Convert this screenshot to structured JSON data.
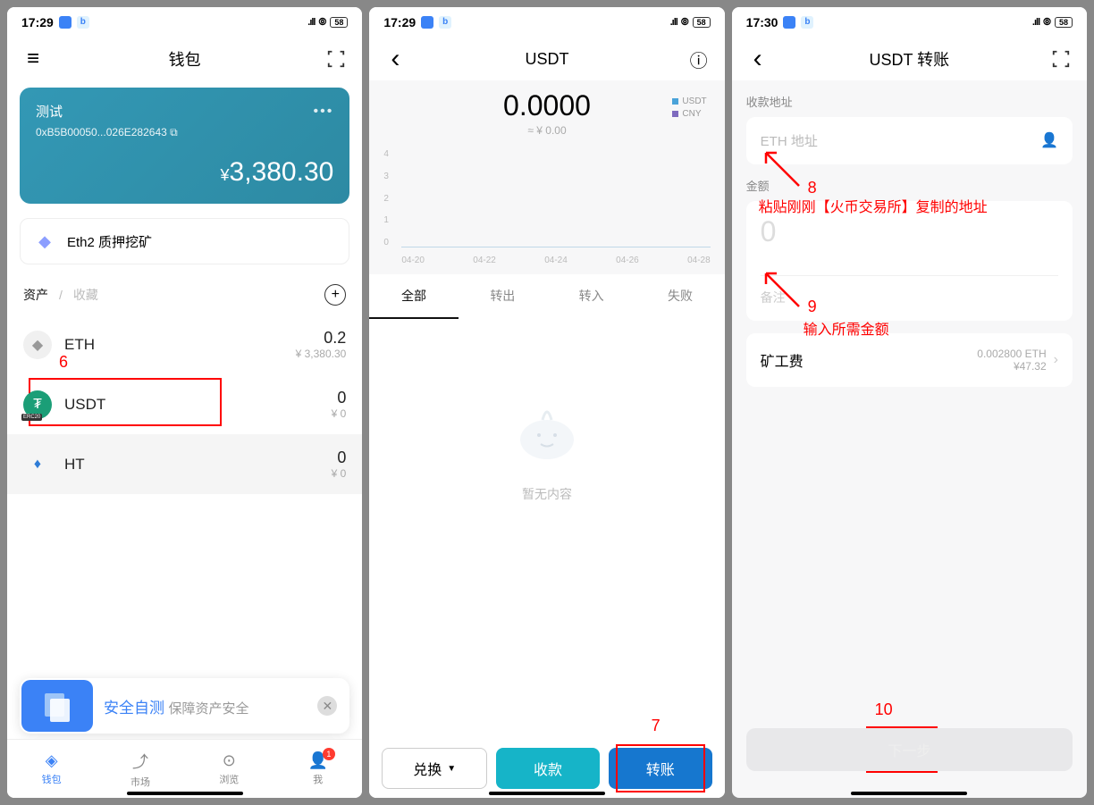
{
  "screen1": {
    "status": {
      "time": "17:29",
      "battery": "58"
    },
    "header": {
      "title": "钱包"
    },
    "wallet_card": {
      "name": "测试",
      "addr": "0xB5B00050...026E282643",
      "balance": "3,380.30",
      "currency": "¥"
    },
    "eth2_row": "Eth2 质押挖矿",
    "sections": {
      "assets": "资产",
      "favorites": "收藏"
    },
    "assets": [
      {
        "sym": "ETH",
        "bal": "0.2",
        "fiat": "¥ 3,380.30"
      },
      {
        "sym": "USDT",
        "bal": "0",
        "fiat": "¥ 0"
      },
      {
        "sym": "HT",
        "bal": "0",
        "fiat": "¥ 0"
      }
    ],
    "promo": {
      "title": "安全自测",
      "sub": "保障资产安全"
    },
    "tabs": {
      "wallet": "钱包",
      "market": "市场",
      "browse": "浏览",
      "me": "我",
      "badge": "1"
    },
    "annotation": "6"
  },
  "screen2": {
    "status": {
      "time": "17:29",
      "battery": "58"
    },
    "header": {
      "title": "USDT"
    },
    "balance": "0.0000",
    "balance_fiat": "≈ ¥ 0.00",
    "legend": {
      "usdt": "USDT",
      "cny": "CNY"
    },
    "chart_data": {
      "type": "line",
      "y_ticks": [
        "4",
        "3",
        "2",
        "1",
        "0"
      ],
      "x_ticks": [
        "04-20",
        "04-22",
        "04-24",
        "04-26",
        "04-28"
      ],
      "series": [
        {
          "name": "USDT",
          "values": [
            0,
            0,
            0,
            0,
            0
          ]
        }
      ]
    },
    "tx_tabs": {
      "all": "全部",
      "out": "转出",
      "in": "转入",
      "failed": "失败"
    },
    "empty": "暂无内容",
    "actions": {
      "exchange": "兑换",
      "receive": "收款",
      "transfer": "转账"
    },
    "annotation": "7"
  },
  "screen3": {
    "status": {
      "time": "17:30",
      "battery": "58"
    },
    "header": {
      "title": "USDT 转账"
    },
    "label_addr": "收款地址",
    "ph_addr": "ETH 地址",
    "label_amount": "金额",
    "ph_amount": "0",
    "ph_note": "备注",
    "fee_label": "矿工费",
    "fee_eth": "0.002800 ETH",
    "fee_fiat": "¥47.32",
    "next": "下一步",
    "annotations": {
      "n8": "8",
      "t8": "粘贴刚刚【火币交易所】复制的地址",
      "n9": "9",
      "t9": "输入所需金额",
      "n10": "10"
    }
  }
}
